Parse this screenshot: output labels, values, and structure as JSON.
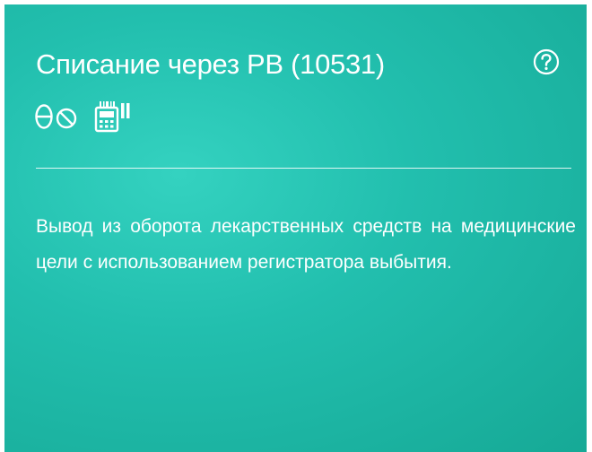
{
  "card": {
    "title": "Списание через РВ (10531)",
    "description": "Вывод из оборота лекарственных средств на медицинские цели с использованием регистратора выбытия.",
    "icons": [
      "help-icon",
      "drug-icon",
      "scanner-icon"
    ],
    "colors": {
      "background": "#22bfae",
      "text": "#ffffff"
    }
  }
}
